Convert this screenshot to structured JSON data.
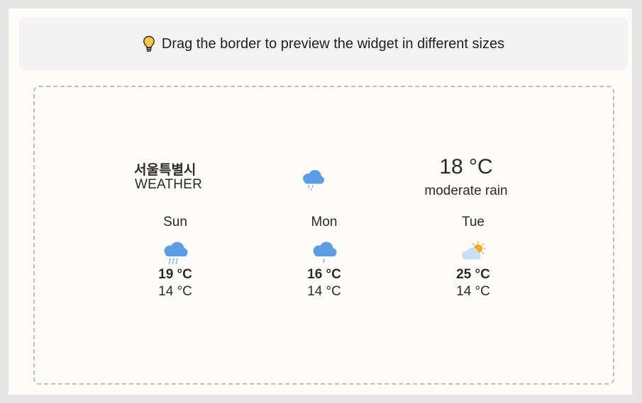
{
  "banner": {
    "icon": "lightbulb-icon",
    "text": "Drag the border to preview the widget in different sizes"
  },
  "widget": {
    "city": "서울특별시",
    "label": "WEATHER",
    "current": {
      "icon": "rain-cloud-icon",
      "temperature": "18 °C",
      "description": "moderate rain"
    },
    "days": [
      {
        "name": "Sun",
        "icon": "heavy-rain-cloud-icon",
        "high": "19 °C",
        "low": "14 °C"
      },
      {
        "name": "Mon",
        "icon": "rain-cloud-icon",
        "high": "16 °C",
        "low": "14 °C"
      },
      {
        "name": "Tue",
        "icon": "sun-behind-cloud-icon",
        "high": "25 °C",
        "low": "14 °C"
      }
    ]
  },
  "colors": {
    "cloud_blue": "#5b9ee6",
    "rain_blue": "#6aa8e8",
    "sun_orange": "#f5a623",
    "light_cloud": "#c9dff5",
    "bulb_yellow": "#f7c843"
  }
}
